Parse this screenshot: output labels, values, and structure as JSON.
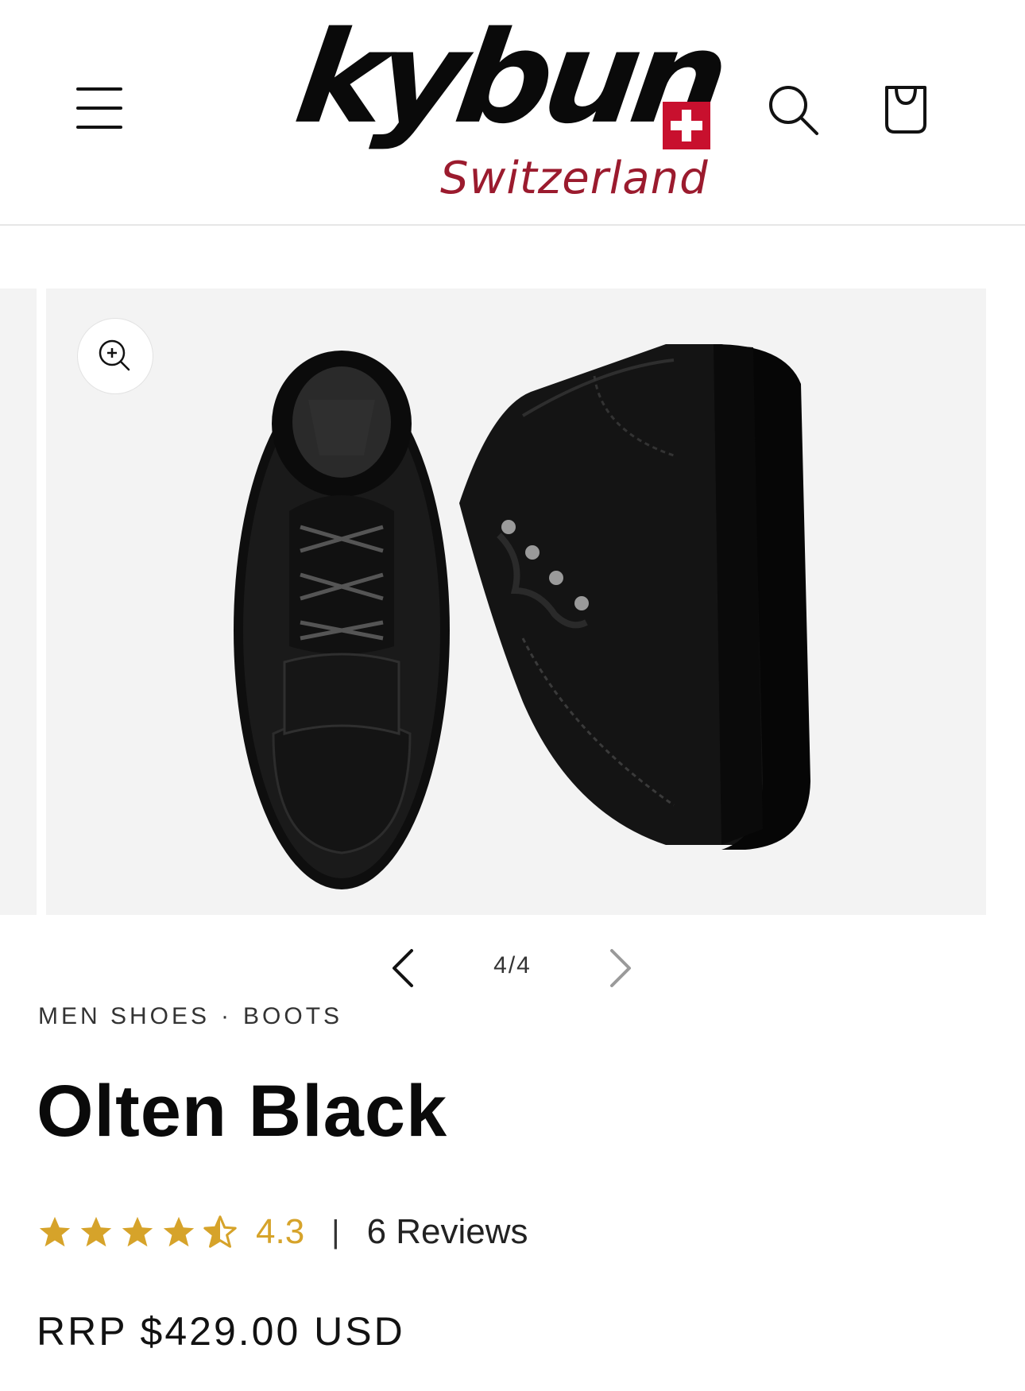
{
  "header": {
    "logo_text": "kybun",
    "logo_subtitle": "Switzerland",
    "brand_red": "#c8102e",
    "menu_icon": "hamburger-menu-icon",
    "search_icon": "search-icon",
    "cart_icon": "cart-icon"
  },
  "gallery": {
    "zoom_icon": "zoom-in-icon",
    "counter": "4/4",
    "current": 4,
    "total": 4,
    "background": "#f3f3f3"
  },
  "product": {
    "breadcrumb": [
      "MEN SHOES",
      "BOOTS"
    ],
    "breadcrumb_separator": "·",
    "title": "Olten Black",
    "rating": {
      "value": "4.3",
      "stars_filled": 4.3,
      "stars_total": 5,
      "divider": "|",
      "reviews_label": "6 Reviews",
      "star_color": "#d6a32a"
    },
    "price": "RRP $429.00 USD"
  }
}
